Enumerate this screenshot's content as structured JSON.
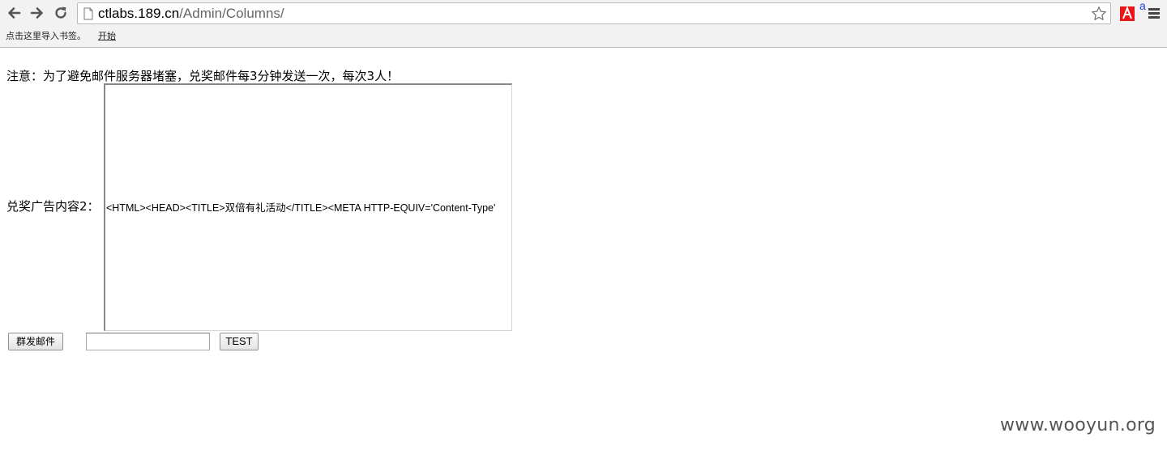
{
  "browser": {
    "url_host": "ctlabs.189.cn",
    "url_path": "/Admin/Columns/",
    "translate_label": "a",
    "bookmarks_bar": {
      "import_text": "点击这里导入书签。",
      "start_link": "开始"
    }
  },
  "page": {
    "notice": "注意：为了避免邮件服务器堵塞，兑奖邮件每3分钟发送一次，每次3人！",
    "ad_label": "兑奖广告内容2：",
    "ad_content": "<HTML><HEAD><TITLE>双倍有礼活动</TITLE><META HTTP-EQUIV='Content-Type' ",
    "send_button": "群发邮件",
    "test_input_value": "",
    "test_button": "TEST"
  },
  "watermark": "www.wooyun.org"
}
